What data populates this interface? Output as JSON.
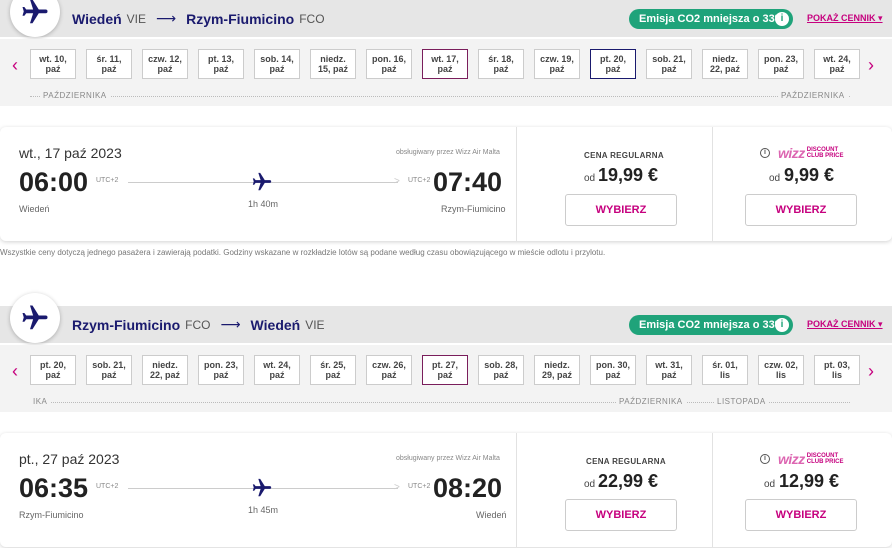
{
  "outbound": {
    "origin_city": "Wiedeń",
    "origin_code": "VIE",
    "dest_city": "Rzym-Fiumicino",
    "dest_code": "FCO",
    "co2_label": "Emisja CO2 mniejsza o 33%",
    "show_prices": "POKAŻ CENNIK",
    "dates": [
      {
        "l1": "wt. 10,",
        "l2": "paź"
      },
      {
        "l1": "śr. 11,",
        "l2": "paź"
      },
      {
        "l1": "czw. 12,",
        "l2": "paź"
      },
      {
        "l1": "pt. 13,",
        "l2": "paź"
      },
      {
        "l1": "sob. 14,",
        "l2": "paź"
      },
      {
        "l1": "niedz.",
        "l2": "15, paź"
      },
      {
        "l1": "pon. 16,",
        "l2": "paź"
      },
      {
        "l1": "wt. 17,",
        "l2": "paź"
      },
      {
        "l1": "śr. 18,",
        "l2": "paź"
      },
      {
        "l1": "czw. 19,",
        "l2": "paź"
      },
      {
        "l1": "pt. 20,",
        "l2": "paź"
      },
      {
        "l1": "sob. 21,",
        "l2": "paź"
      },
      {
        "l1": "niedz.",
        "l2": "22, paź"
      },
      {
        "l1": "pon. 23,",
        "l2": "paź"
      },
      {
        "l1": "wt. 24,",
        "l2": "paź"
      }
    ],
    "month_left": "PAŹDZIERNIKA",
    "month_right": "PAŹDZIERNIKA",
    "flight": {
      "date": "wt., 17 paź 2023",
      "dep_time": "06:00",
      "dep_tz": "UTC+2",
      "arr_time": "07:40",
      "arr_tz": "UTC+2",
      "dep_city": "Wiedeń",
      "arr_city": "Rzym-Fiumicino",
      "duration": "1h 40m",
      "operated": "obsługiwany przez Wizz Air Malta",
      "regular_label": "CENA REGULARNA",
      "regular_od": "od",
      "regular_price": "19,99 €",
      "wdc_od": "od",
      "wdc_price": "9,99 €",
      "select": "WYBIERZ"
    }
  },
  "note": "Wszystkie ceny dotyczą jednego pasażera i zawierają podatki. Godziny wskazane w rozkładzie lotów są podane według czasu obowiązującego w mieście odlotu i przylotu.",
  "inbound": {
    "origin_city": "Rzym-Fiumicino",
    "origin_code": "FCO",
    "dest_city": "Wiedeń",
    "dest_code": "VIE",
    "co2_label": "Emisja CO2 mniejsza o 33%",
    "show_prices": "POKAŻ CENNIK",
    "dates": [
      {
        "l1": "pt. 20,",
        "l2": "paź"
      },
      {
        "l1": "sob. 21,",
        "l2": "paź"
      },
      {
        "l1": "niedz.",
        "l2": "22, paź"
      },
      {
        "l1": "pon. 23,",
        "l2": "paź"
      },
      {
        "l1": "wt. 24,",
        "l2": "paź"
      },
      {
        "l1": "śr. 25,",
        "l2": "paź"
      },
      {
        "l1": "czw. 26,",
        "l2": "paź"
      },
      {
        "l1": "pt. 27,",
        "l2": "paź"
      },
      {
        "l1": "sob. 28,",
        "l2": "paź"
      },
      {
        "l1": "niedz.",
        "l2": "29, paź"
      },
      {
        "l1": "pon. 30,",
        "l2": "paź"
      },
      {
        "l1": "wt. 31,",
        "l2": "paź"
      },
      {
        "l1": "śr. 01,",
        "l2": "lis"
      },
      {
        "l1": "czw. 02,",
        "l2": "lis"
      },
      {
        "l1": "pt. 03,",
        "l2": "lis"
      }
    ],
    "month_left": "IKA",
    "month_mid": "PAŹDZIERNIKA",
    "month_right": "LISTOPADA",
    "flight": {
      "date": "pt., 27 paź 2023",
      "dep_time": "06:35",
      "dep_tz": "UTC+2",
      "arr_time": "08:20",
      "arr_tz": "UTC+2",
      "dep_city": "Rzym-Fiumicino",
      "arr_city": "Wiedeń",
      "duration": "1h 45m",
      "operated": "obsługiwany przez Wizz Air Malta",
      "regular_label": "CENA REGULARNA",
      "regular_od": "od",
      "regular_price": "22,99 €",
      "wdc_od": "od",
      "wdc_price": "12,99 €",
      "select": "WYBIERZ"
    }
  },
  "brand": {
    "wizz": "wizz",
    "discount_line1": "DISCOUNT",
    "discount_line2": "CLUB PRICE"
  },
  "icons": {
    "plane": "plane-icon",
    "info": "info-icon",
    "chevron_left": "chevron-left-icon",
    "chevron_right": "chevron-right-icon"
  },
  "colors": {
    "brand_magenta": "#c6007e",
    "navy": "#1a1a6e",
    "co2_green": "#1fa37a"
  }
}
